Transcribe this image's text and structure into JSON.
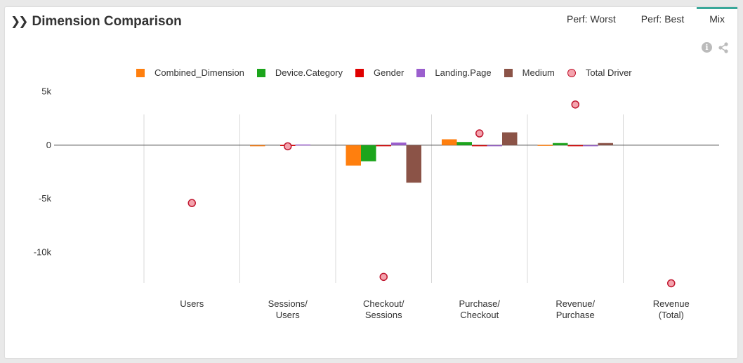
{
  "header": {
    "title": "Dimension Comparison"
  },
  "tabs": [
    {
      "label": "Perf: Worst",
      "active": false
    },
    {
      "label": "Perf: Best",
      "active": false
    },
    {
      "label": "Mix",
      "active": true
    }
  ],
  "icons": {
    "info": "info-icon",
    "share": "share-icon",
    "expand": "double-chevron-icon"
  },
  "chart_data": {
    "type": "bar",
    "title": "",
    "xlabel": "",
    "ylabel": "",
    "ylim": [
      -13000,
      5300
    ],
    "yticks": [
      {
        "value": 5000,
        "label": "5k"
      },
      {
        "value": 0,
        "label": "0"
      },
      {
        "value": -5000,
        "label": "-5k"
      },
      {
        "value": -10000,
        "label": "-10k"
      }
    ],
    "categories": [
      [
        "Users"
      ],
      [
        "Sessions/",
        "Users"
      ],
      [
        "Checkout/",
        "Sessions"
      ],
      [
        "Purchase/",
        "Checkout"
      ],
      [
        "Revenue/",
        "Purchase"
      ],
      [
        "Revenue",
        "(Total)"
      ]
    ],
    "legend_position": "top",
    "series": [
      {
        "name": "Combined_Dimension",
        "color": "#ff7f0e",
        "values": [
          0,
          -100,
          -1900,
          550,
          30,
          0
        ]
      },
      {
        "name": "Device.Category",
        "color": "#1ca51c",
        "values": [
          0,
          0,
          -1500,
          300,
          200,
          0
        ]
      },
      {
        "name": "Gender",
        "color": "#e00000",
        "values": [
          0,
          20,
          -100,
          -100,
          -100,
          0
        ]
      },
      {
        "name": "Landing.Page",
        "color": "#9b5fce",
        "values": [
          0,
          70,
          250,
          -100,
          -100,
          0
        ]
      },
      {
        "name": "Medium",
        "color": "#8b5347",
        "values": [
          0,
          0,
          -3500,
          1200,
          200,
          0
        ]
      }
    ],
    "driver": {
      "name": "Total Driver",
      "color": "#c0162f",
      "fill": "#f4a3ad",
      "values": [
        -5400,
        -100,
        -12300,
        1100,
        3800,
        -12900
      ]
    }
  }
}
